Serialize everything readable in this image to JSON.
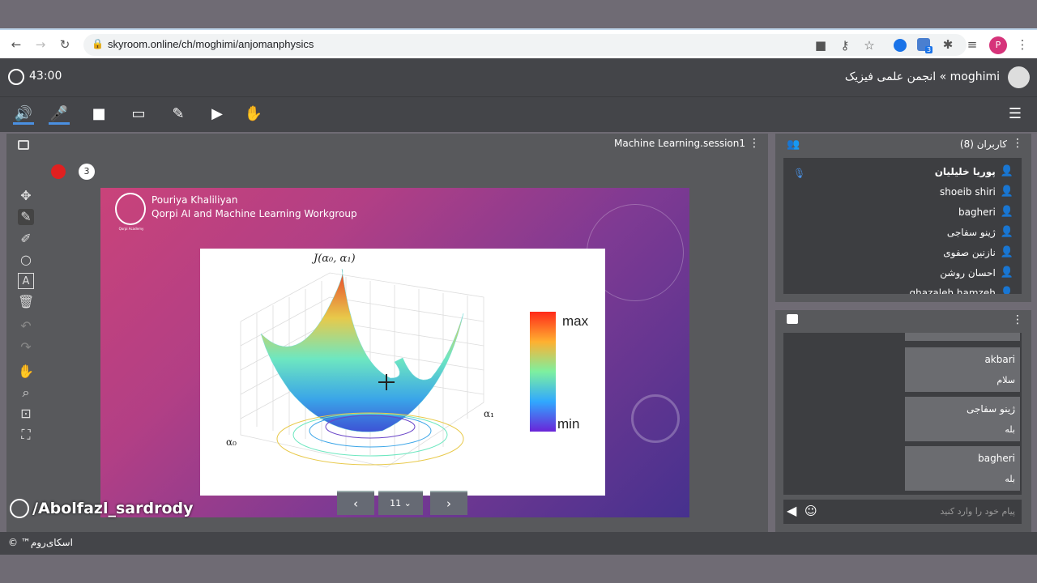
{
  "browser": {
    "url": "skyroom.online/ch/moghimi/anjomanphysics",
    "profile_initial": "P",
    "ext_badge": "3"
  },
  "header": {
    "timer": "43:00",
    "room_title": "moghimi » انجمن علمی فیزیک"
  },
  "stage": {
    "title": "Machine Learning.session1",
    "badge_count": "3",
    "page_select": "11",
    "watermark": "/Abolfazl_sardrody"
  },
  "slide": {
    "author": "Pouriya Khaliliyan",
    "workgroup": "Qorpi AI and Machine Learning Workgroup",
    "logo_caption": "Qorpi Academy"
  },
  "plot": {
    "title": "J(α₀, α₁)",
    "xlabel": "α₀",
    "ylabel": "α₁",
    "colorbar_max": "max",
    "colorbar_min": "min"
  },
  "users": {
    "header": "کاربران (8)",
    "list": [
      {
        "name": "پوریا خلیلیان",
        "bold": true
      },
      {
        "name": "shoeib shiri"
      },
      {
        "name": "bagheri"
      },
      {
        "name": "ژینو سفاجی"
      },
      {
        "name": "نازنین صفوی"
      },
      {
        "name": "احسان روشن"
      },
      {
        "name": "ghazaleh hamzeh"
      }
    ]
  },
  "chat": {
    "messages": [
      {
        "name": "akbari",
        "text": "سلام"
      },
      {
        "name": "ژینو سفاجی",
        "text": "بله"
      },
      {
        "name": "bagheri",
        "text": "بله"
      }
    ],
    "placeholder": "پیام خود را وارد کنید"
  },
  "footer": {
    "brand": "اسکای‌روم™ ©"
  },
  "colors": {
    "accent": "#4a90e2",
    "userIcon": "#f2c94c"
  }
}
